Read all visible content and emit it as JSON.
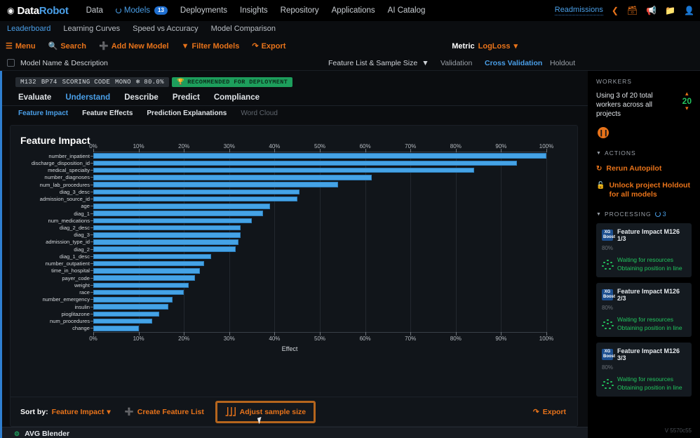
{
  "topnav": {
    "logo_text_white": "Data",
    "logo_text_blue": "Robot",
    "items": [
      {
        "label": "Data",
        "active": false
      },
      {
        "label": "Models",
        "active": true,
        "badge": "13"
      },
      {
        "label": "Deployments",
        "active": false
      },
      {
        "label": "Insights",
        "active": false
      },
      {
        "label": "Repository",
        "active": false
      },
      {
        "label": "Applications",
        "active": false
      },
      {
        "label": "AI Catalog",
        "active": false
      }
    ],
    "project_name": "Readmissions",
    "icons": [
      "share-icon",
      "save-icon",
      "announcement-icon",
      "folder-icon",
      "user-icon"
    ]
  },
  "tabstrip": {
    "tabs": [
      {
        "label": "Leaderboard",
        "active": true
      },
      {
        "label": "Learning Curves",
        "active": false
      },
      {
        "label": "Speed vs Accuracy",
        "active": false
      },
      {
        "label": "Model Comparison",
        "active": false
      }
    ]
  },
  "toolbar": {
    "buttons": [
      {
        "label": "Menu",
        "icon": "hamburger-icon"
      },
      {
        "label": "Search",
        "icon": "search-icon"
      },
      {
        "label": "Add New Model",
        "icon": "plus-icon"
      },
      {
        "label": "Filter Models",
        "icon": "funnel-icon"
      },
      {
        "label": "Export",
        "icon": "export-icon"
      }
    ],
    "metric_label": "Metric",
    "metric_value": "LogLoss"
  },
  "tablehead": {
    "model_col": "Model Name & Description",
    "feature_list_col": "Feature List & Sample Size",
    "validation": "Validation",
    "cross_validation": "Cross Validation",
    "holdout": "Holdout"
  },
  "model": {
    "chips": [
      "M132",
      "BP74",
      "SCORING CODE",
      "MONO",
      "❄ 80.0%"
    ],
    "recommended": "RECOMMENDED FOR DEPLOYMENT",
    "section_tabs": [
      {
        "label": "Evaluate",
        "active": false
      },
      {
        "label": "Understand",
        "active": true
      },
      {
        "label": "Describe",
        "active": false
      },
      {
        "label": "Predict",
        "active": false
      },
      {
        "label": "Compliance",
        "active": false
      }
    ],
    "sub_tabs": [
      {
        "label": "Feature Impact",
        "active": true,
        "dim": false
      },
      {
        "label": "Feature Effects",
        "active": false,
        "dim": false
      },
      {
        "label": "Prediction Explanations",
        "active": false,
        "dim": false
      },
      {
        "label": "Word Cloud",
        "active": false,
        "dim": true
      }
    ],
    "card_title": "Feature Impact"
  },
  "chart_data": {
    "type": "bar",
    "orientation": "horizontal",
    "title": "Feature Impact",
    "xlabel": "Effect",
    "ylabel": "",
    "xlim": [
      0,
      100
    ],
    "grid": true,
    "legend": false,
    "tick_labels": [
      "0%",
      "10%",
      "20%",
      "30%",
      "40%",
      "50%",
      "60%",
      "70%",
      "80%",
      "90%",
      "100%"
    ],
    "ticks": [
      0,
      10,
      20,
      30,
      40,
      50,
      60,
      70,
      80,
      90,
      100
    ],
    "categories": [
      "number_inpatient",
      "discharge_disposition_id",
      "medical_specialty",
      "number_diagnoses",
      "num_lab_procedures",
      "diag_3_desc",
      "admission_source_id",
      "age",
      "diag_1",
      "num_medications",
      "diag_2_desc",
      "diag_3",
      "admission_type_id",
      "diag_2",
      "diag_1_desc",
      "number_outpatient",
      "time_in_hospital",
      "payer_code",
      "weight",
      "race",
      "number_emergency",
      "insulin",
      "pioglitazone",
      "num_procedures",
      "change"
    ],
    "values": [
      100.0,
      93.5,
      84.0,
      61.5,
      54.0,
      45.5,
      45.0,
      39.0,
      37.5,
      35.0,
      32.5,
      32.5,
      32.0,
      31.5,
      26.0,
      24.5,
      23.5,
      22.5,
      21.0,
      20.0,
      17.5,
      16.5,
      14.5,
      13.0,
      10.0
    ],
    "bar_color": "#45a3e6",
    "bar_border_color": "#2d7fbd"
  },
  "chart_footer": {
    "sort_label": "Sort by:",
    "sort_value": "Feature Impact",
    "create_feature_list": "Create Feature List",
    "adjust_sample_size": "Adjust sample size",
    "export": "Export"
  },
  "next_model": {
    "name": "AVG Blender"
  },
  "sidebar": {
    "workers_heading": "WORKERS",
    "workers_text": "Using 3 of 20 total workers across all projects",
    "worker_count": "20",
    "actions_heading": "ACTIONS",
    "actions": [
      {
        "label": "Rerun Autopilot",
        "icon": "refresh-icon"
      },
      {
        "label": "Unlock project Holdout for all models",
        "icon": "lock-icon"
      }
    ],
    "processing_heading": "PROCESSING",
    "processing_count": "3",
    "processing_items": [
      {
        "badge": "XG Boost",
        "name": "Feature Impact M126 1/3",
        "percent": "80%",
        "status_line1": "Waiting for resources",
        "status_line2": "Obtaining position in line"
      },
      {
        "badge": "XG Boost",
        "name": "Feature Impact M126 2/3",
        "percent": "80%",
        "status_line1": "Waiting for resources",
        "status_line2": "Obtaining position in line"
      },
      {
        "badge": "XG Boost",
        "name": "Feature Impact M126 3/3",
        "percent": "80%",
        "status_line1": "Waiting for resources",
        "status_line2": "Obtaining position in line"
      }
    ],
    "version": "V 5570c55"
  },
  "colors": {
    "accent_orange": "#e8731a",
    "accent_blue": "#4a9fe8",
    "green": "#22c55e",
    "bar": "#45a3e6"
  }
}
